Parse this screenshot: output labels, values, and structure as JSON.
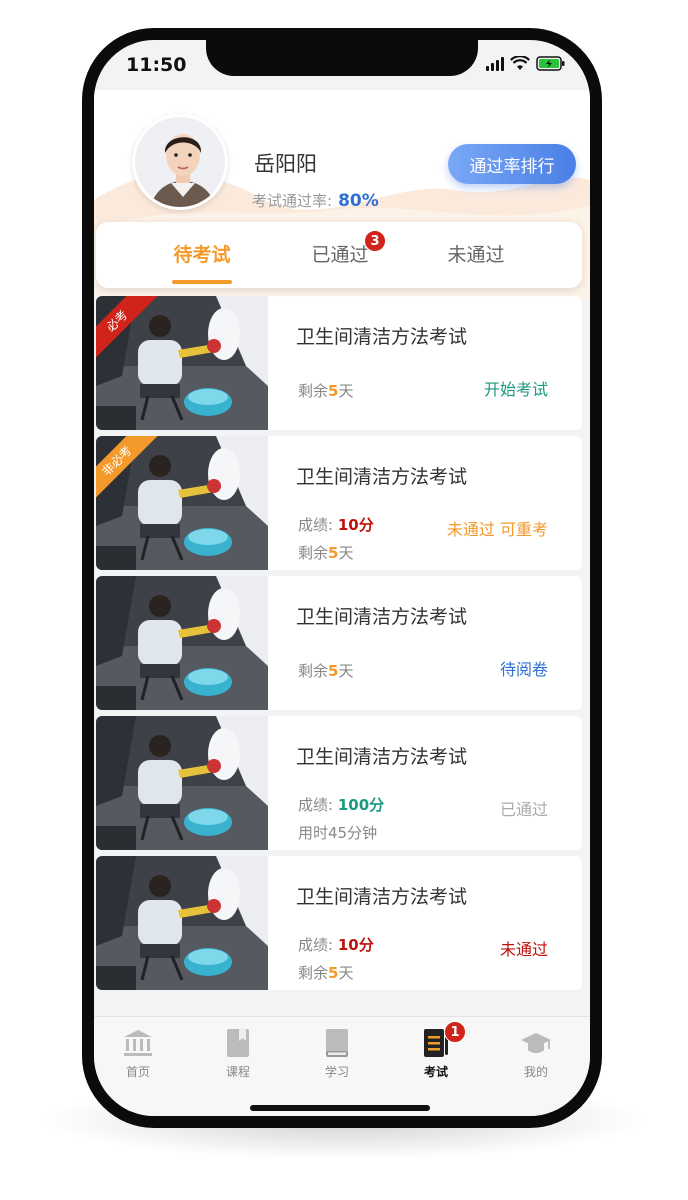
{
  "status": {
    "time": "11:50"
  },
  "profile": {
    "name": "岳阳阳",
    "pass_rate_label": "考试通过率:",
    "pass_rate_value": "80%",
    "rank_button": "通过率排行"
  },
  "tabs": [
    {
      "label": "待考试",
      "active": true
    },
    {
      "label": "已通过",
      "badge": "3"
    },
    {
      "label": "未通过"
    }
  ],
  "exams": [
    {
      "title": "卫生间清洁方法考试",
      "ribbon": "必考",
      "ribbon_color": "#d0241a",
      "remaining_prefix": "剩余",
      "remaining_value": "5",
      "remaining_suffix": "天",
      "action": "开始考试",
      "action_color": "#1a9a80"
    },
    {
      "title": "卫生间清洁方法考试",
      "ribbon": "非必考",
      "ribbon_color": "#f39a2b",
      "score_label": "成绩:",
      "score_value": "10分",
      "score_color": "#c0120c",
      "remaining_prefix": "剩余",
      "remaining_value": "5",
      "remaining_suffix": "天",
      "action": "未通过 可重考",
      "action_color": "#f39a2b"
    },
    {
      "title": "卫生间清洁方法考试",
      "remaining_prefix": "剩余",
      "remaining_value": "5",
      "remaining_suffix": "天",
      "action": "待阅卷",
      "action_color": "#2f6fd1"
    },
    {
      "title": "卫生间清洁方法考试",
      "score_label": "成绩:",
      "score_value": "100分",
      "score_color": "#1a9a80",
      "duration": "用时45分钟",
      "action": "已通过",
      "action_color": "#aaaaaa"
    },
    {
      "title": "卫生间清洁方法考试",
      "score_label": "成绩:",
      "score_value": "10分",
      "score_color": "#c0120c",
      "remaining_prefix": "剩余",
      "remaining_value": "5",
      "remaining_suffix": "天",
      "action": "未通过",
      "action_color": "#c0120c"
    }
  ],
  "nav": [
    {
      "label": "首页",
      "icon": "bank-icon"
    },
    {
      "label": "课程",
      "icon": "bookmark-book-icon"
    },
    {
      "label": "学习",
      "icon": "book-icon"
    },
    {
      "label": "考试",
      "icon": "exam-list-icon",
      "active": true,
      "badge": "1"
    },
    {
      "label": "我的",
      "icon": "graduation-cap-icon"
    }
  ],
  "colors": {
    "accent": "#f39a2b",
    "primary_blue": "#4a7fe6",
    "badge_red": "#d0241a"
  }
}
